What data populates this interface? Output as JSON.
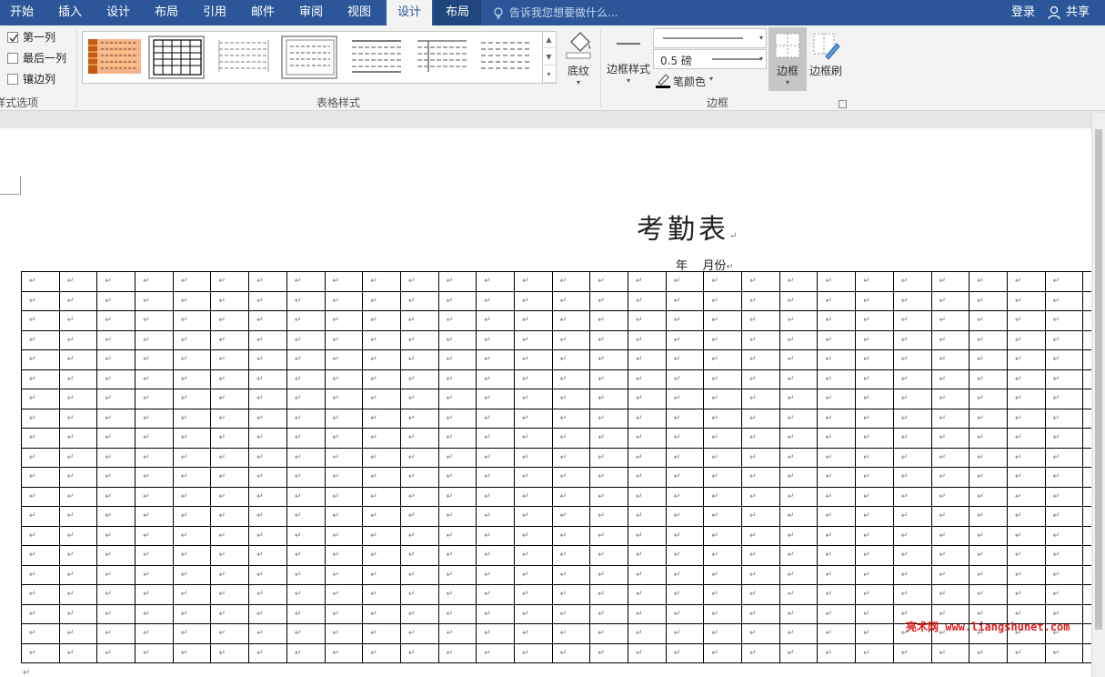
{
  "tabs": [
    {
      "label": "开始"
    },
    {
      "label": "插入"
    },
    {
      "label": "设计"
    },
    {
      "label": "布局"
    },
    {
      "label": "引用"
    },
    {
      "label": "邮件"
    },
    {
      "label": "审阅"
    },
    {
      "label": "视图"
    },
    {
      "label": "设计"
    },
    {
      "label": "布局"
    }
  ],
  "tell_me": "告诉我您想要做什么...",
  "login": "登录",
  "share": "共享",
  "style_options": {
    "label": "样式选项",
    "items": [
      {
        "label": "第一列",
        "checked": true
      },
      {
        "label": "最后一列",
        "checked": false
      },
      {
        "label": "镶边列",
        "checked": false
      }
    ]
  },
  "table_styles": {
    "label": "表格样式"
  },
  "shading": {
    "label": "底纹"
  },
  "borders": {
    "group_label": "边框",
    "border_styles": "边框样式",
    "weight": "0.5 磅",
    "pen_color": "笔颜色",
    "border_btn": "边框",
    "border_painter": "边框刷"
  },
  "document": {
    "title": "考勤表",
    "subtitle": "年    月份",
    "para_mark": "↵",
    "rows": 20,
    "cols": 29
  },
  "watermark": "亮术网 www.liangshunet.com"
}
